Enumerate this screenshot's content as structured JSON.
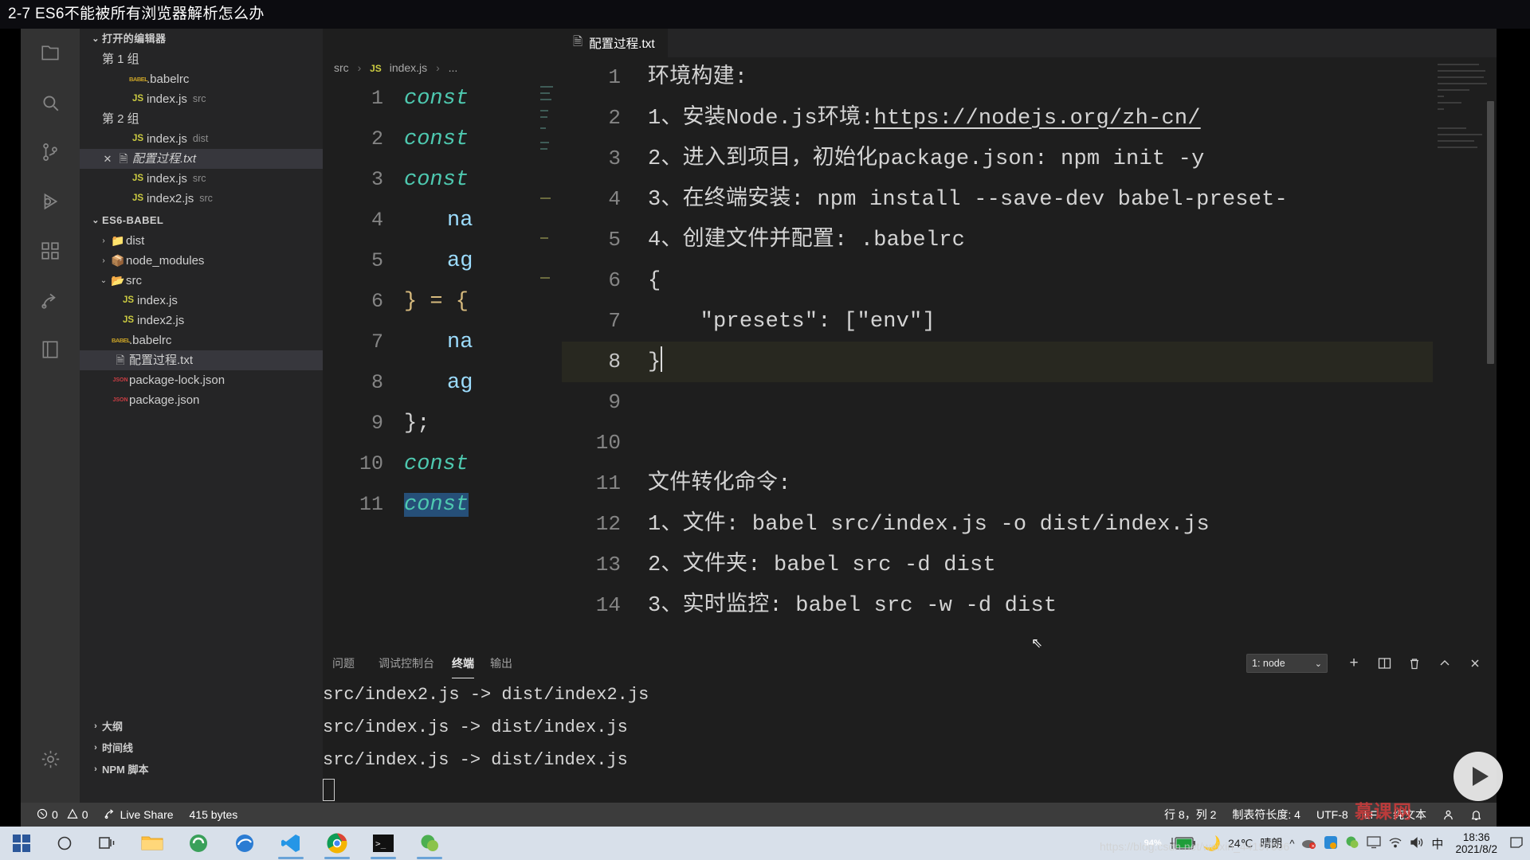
{
  "titlebar": {
    "text": "2-7 ES6不能被所有浏览器解析怎么办"
  },
  "activitybar": {
    "items": [
      {
        "name": "explorer-icon",
        "label": "资源管理器"
      },
      {
        "name": "search-icon",
        "label": "搜索"
      },
      {
        "name": "source-control-icon",
        "label": "源代码管理"
      },
      {
        "name": "debug-icon",
        "label": "运行和调试"
      },
      {
        "name": "extensions-icon",
        "label": "扩展"
      },
      {
        "name": "liveshare-icon",
        "label": "Live Share"
      },
      {
        "name": "library-icon",
        "label": "书库"
      },
      {
        "name": "settings-gear-icon",
        "label": "管理"
      }
    ]
  },
  "sidebar": {
    "open_editors": {
      "title": "打开的编辑器",
      "groups": [
        {
          "title": "第 1 组",
          "files": [
            {
              "name": ".babelrc",
              "folder": "",
              "icon": "babel",
              "dirty": false,
              "selected": false
            },
            {
              "name": "index.js",
              "folder": "src",
              "icon": "js",
              "dirty": false,
              "selected": false
            }
          ]
        },
        {
          "title": "第 2 组",
          "files": [
            {
              "name": "index.js",
              "folder": "dist",
              "icon": "js",
              "dirty": false,
              "selected": false
            },
            {
              "name": "配置过程.txt",
              "folder": "",
              "icon": "txt",
              "dirty": true,
              "selected": true
            },
            {
              "name": "index.js",
              "folder": "src",
              "icon": "js",
              "dirty": false,
              "selected": false
            },
            {
              "name": "index2.js",
              "folder": "src",
              "icon": "js",
              "dirty": false,
              "selected": false
            }
          ]
        }
      ]
    },
    "project": {
      "title": "ES6-BABEL",
      "tree": [
        {
          "label": "dist",
          "type": "folder",
          "expanded": false,
          "depth": 1,
          "selected": false
        },
        {
          "label": "node_modules",
          "type": "folder",
          "expanded": false,
          "depth": 1,
          "selected": false
        },
        {
          "label": "src",
          "type": "folder",
          "expanded": true,
          "depth": 1,
          "selected": false
        },
        {
          "label": "index.js",
          "type": "js",
          "depth": 2,
          "selected": false
        },
        {
          "label": "index2.js",
          "type": "js",
          "depth": 2,
          "selected": false
        },
        {
          "label": ".babelrc",
          "type": "babel",
          "depth": 2,
          "selected": false
        },
        {
          "label": "配置过程.txt",
          "type": "txt",
          "depth": 2,
          "selected": true
        },
        {
          "label": "package-lock.json",
          "type": "json",
          "depth": 2,
          "selected": false
        },
        {
          "label": "package.json",
          "type": "json",
          "depth": 2,
          "selected": false
        }
      ]
    },
    "bottom_sections": [
      {
        "label": "大纲"
      },
      {
        "label": "时间线"
      },
      {
        "label": "NPM 脚本"
      }
    ]
  },
  "editor_group_1": {
    "breadcrumb": {
      "folder": "src",
      "file": "index.js",
      "tail": "..."
    },
    "lines": [
      {
        "num": "1",
        "text": "const"
      },
      {
        "num": "2",
        "text": "const"
      },
      {
        "num": "3",
        "text": "const"
      },
      {
        "num": "4",
        "text": "na"
      },
      {
        "num": "5",
        "text": "ag"
      },
      {
        "num": "6",
        "text": "} = {"
      },
      {
        "num": "7",
        "text": "na"
      },
      {
        "num": "8",
        "text": "ag"
      },
      {
        "num": "9",
        "text": "};"
      },
      {
        "num": "10",
        "text": "const"
      },
      {
        "num": "11",
        "text": "const"
      }
    ]
  },
  "editor_group_2": {
    "tab": {
      "label": "配置过程.txt",
      "icon": "txt-file-icon"
    },
    "lines": [
      {
        "num": "1",
        "text": "环境构建:",
        "current": false
      },
      {
        "num": "2",
        "text": "1、安装Node.js环境: ",
        "link": "https://nodejs.org/zh-cn/",
        "current": false
      },
      {
        "num": "3",
        "text": "2、进入到项目，初始化package.json: npm init -y",
        "current": false
      },
      {
        "num": "4",
        "text": "3、在终端安装: npm install --save-dev babel-preset-",
        "current": false
      },
      {
        "num": "5",
        "text": "4、创建文件并配置: .babelrc",
        "current": false
      },
      {
        "num": "6",
        "text": "{",
        "current": false
      },
      {
        "num": "7",
        "text": "    \"presets\": [\"env\"]",
        "current": false
      },
      {
        "num": "8",
        "text": "}",
        "current": true
      },
      {
        "num": "9",
        "text": "",
        "current": false
      },
      {
        "num": "10",
        "text": "",
        "current": false
      },
      {
        "num": "11",
        "text": "文件转化命令:",
        "current": false
      },
      {
        "num": "12",
        "text": "1、文件: babel src/index.js -o dist/index.js",
        "current": false
      },
      {
        "num": "13",
        "text": "2、文件夹: babel src -d dist",
        "current": false
      },
      {
        "num": "14",
        "text": "3、实时监控: babel src -w -d dist",
        "current": false
      }
    ]
  },
  "panel": {
    "tabs": [
      {
        "label": "问题",
        "active": false
      },
      {
        "label": "调试控制台",
        "active": false
      },
      {
        "label": "终端",
        "active": true
      },
      {
        "label": "输出",
        "active": false
      }
    ],
    "terminal_select": {
      "value": "1: node"
    },
    "actions": [
      {
        "name": "new-terminal-icon",
        "glyph": "+"
      },
      {
        "name": "split-terminal-icon",
        "glyph": "▣"
      },
      {
        "name": "kill-terminal-icon",
        "glyph": "🗑"
      },
      {
        "name": "maximize-panel-icon",
        "glyph": "^"
      },
      {
        "name": "close-panel-icon",
        "glyph": "✕"
      }
    ],
    "terminal_lines": [
      "src/index2.js -> dist/index2.js",
      "src/index.js -> dist/index.js",
      "src/index.js -> dist/index.js"
    ]
  },
  "statusbar": {
    "errors": "0",
    "warnings": "0",
    "live_share": "Live Share",
    "file_size": "415 bytes",
    "cursor_position": "行 8，列 2",
    "tab_size": "制表符长度: 4",
    "encoding": "UTF-8",
    "eol": "LF",
    "language": "纯文本"
  },
  "taskbar": {
    "apps": [
      {
        "name": "start-button"
      },
      {
        "name": "cortana-search"
      },
      {
        "name": "task-view"
      },
      {
        "name": "file-explorer"
      },
      {
        "name": "qq-browser"
      },
      {
        "name": "edge-browser"
      },
      {
        "name": "vscode"
      },
      {
        "name": "chrome"
      },
      {
        "name": "terminal"
      },
      {
        "name": "wechat"
      }
    ],
    "battery": "94%",
    "weather_temp": "24℃",
    "weather_desc": "晴朗",
    "ime": "中",
    "time": "18:36",
    "date": "2021/8/2"
  },
  "watermarks": {
    "brand": "慕课网",
    "url": "https://blog.csdn.net/weixin_44197006"
  },
  "colors": {
    "accent": "#007acc",
    "editor_bg": "#1e1e1e",
    "sidebar_bg": "#252526",
    "activitybar_bg": "#333333",
    "statusbar_bg": "#3c3c3c",
    "js_yellow": "#cbcb41",
    "json_red": "#cc3e44",
    "teal": "#4ec9b0"
  }
}
